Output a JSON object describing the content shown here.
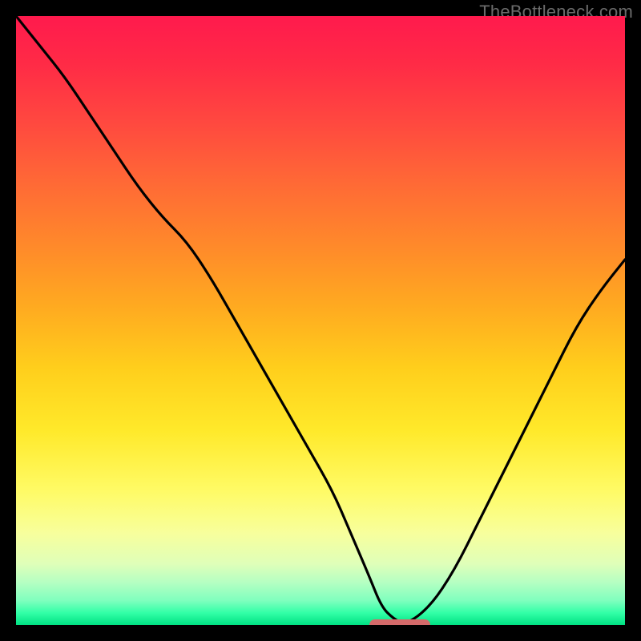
{
  "watermark": {
    "text": "TheBottleneck.com"
  },
  "colors": {
    "curve": "#000000",
    "marker": "#d46a6a",
    "frame_bg": "#000000"
  },
  "chart_data": {
    "type": "line",
    "title": "",
    "xlabel": "",
    "ylabel": "",
    "xlim": [
      0,
      100
    ],
    "ylim": [
      0,
      100
    ],
    "grid": false,
    "legend": false,
    "series": [
      {
        "name": "bottleneck-curve",
        "x": [
          0,
          4,
          8,
          12,
          16,
          20,
          24,
          28,
          32,
          36,
          40,
          44,
          48,
          52,
          55,
          58,
          60,
          62,
          64,
          68,
          72,
          76,
          80,
          84,
          88,
          92,
          96,
          100
        ],
        "y": [
          100,
          95,
          90,
          84,
          78,
          72,
          67,
          63,
          57,
          50,
          43,
          36,
          29,
          22,
          15,
          8,
          3,
          1,
          0,
          3,
          9,
          17,
          25,
          33,
          41,
          49,
          55,
          60
        ]
      }
    ],
    "optimal_marker": {
      "x_start": 58,
      "x_end": 68,
      "y": 0
    }
  }
}
